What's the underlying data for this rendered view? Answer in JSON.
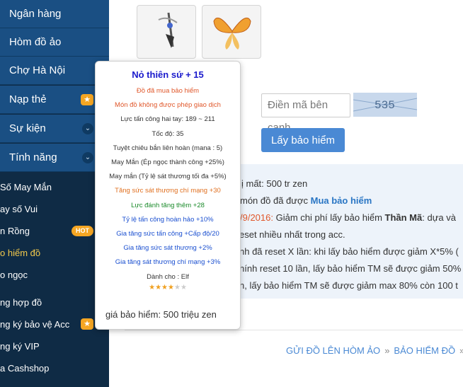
{
  "sidebar": {
    "menu": [
      {
        "label": "Ngân hàng"
      },
      {
        "label": "Hòm đồ ảo"
      },
      {
        "label": "Chợ Hà Nội"
      },
      {
        "label": "Nạp thẻ"
      },
      {
        "label": "Sự kiện"
      },
      {
        "label": "Tính năng"
      }
    ],
    "sub": [
      {
        "label": "Số May Mắn"
      },
      {
        "label": "ay số Vui"
      },
      {
        "label": "n Rồng",
        "badge": "HOT"
      },
      {
        "label": "o hiểm đồ"
      },
      {
        "label": "o ngọc"
      },
      {
        "label": "ng hợp đồ"
      },
      {
        "label": "ng ký bảo vệ Acc"
      },
      {
        "label": "ng ký VIP"
      },
      {
        "label": "a Cashshop"
      }
    ]
  },
  "main": {
    "code_placeholder": "Điền mã bên cạnh",
    "captcha_text": "535",
    "button_label": "Lấy bảo hiểm",
    "info": {
      "l1": "ị mất: 500 tr zen",
      "l2a": "món đồ đã được ",
      "l2b": "Mua bảo hiểm",
      "l3a": "/9/2016: ",
      "l3b": "Giảm chi phí lấy bảo hiểm ",
      "l3c": "Thần Mã",
      "l3d": ": dựa và",
      "l4": "eset nhiều nhất trong acc.",
      "l5": "nh đã reset X lần: khi lấy bảo hiểm được giảm X*5% (",
      "l6": "hính reset 10 lần, lấy bảo hiểm TM sẽ được giảm 50%",
      "l7": "n, lấy bảo hiểm TM sẽ được giảm max 80% còn 100 t"
    },
    "breadcrumb": [
      "GỬI ĐỒ LÊN HÒM ẢO",
      "BẢO HIỂM ĐỒ"
    ],
    "breadcrumb_sep": "»"
  },
  "tooltip": {
    "title": "Nỏ thiên sứ + 15",
    "lines": [
      {
        "text": "Đồ đã mua bảo hiểm",
        "color": "#e0572a"
      },
      {
        "text": "Món đồ không được phép giao dịch",
        "color": "#e0572a"
      },
      {
        "text": "Lực tấn công hai tay: 189 ~ 211",
        "color": "#333333"
      },
      {
        "text": "Tốc độ: 35",
        "color": "#333333"
      },
      {
        "text": "Tuyệt chiêu bắn liên hoàn (mana : 5)",
        "color": "#333333"
      },
      {
        "text": "May Mắn (Ép ngọc thành công +25%)",
        "color": "#333333"
      },
      {
        "text": "May mắn (Tỷ lệ sát thương tối đa +5%)",
        "color": "#333333"
      },
      {
        "text": "Tăng sức sát thương chí mạng +30",
        "color": "#e07020"
      },
      {
        "text": "Lực đánh tăng thêm +28",
        "color": "#1a8a2a"
      },
      {
        "text": "Tỷ lệ tấn công hoàn hảo +10%",
        "color": "#1a4fd0"
      },
      {
        "text": "Gia tăng sức tấn công +Cấp độ/20",
        "color": "#1a4fd0"
      },
      {
        "text": "Gia tăng sức sát thương +2%",
        "color": "#1a4fd0"
      },
      {
        "text": "Gia tăng sát thương chí mạng +3%",
        "color": "#1a4fd0"
      },
      {
        "text": "Dành cho : Elf",
        "color": "#333333"
      }
    ],
    "rating": 4,
    "rating_max": 6,
    "price": "giá bảo hiểm: 500 triệu zen"
  }
}
